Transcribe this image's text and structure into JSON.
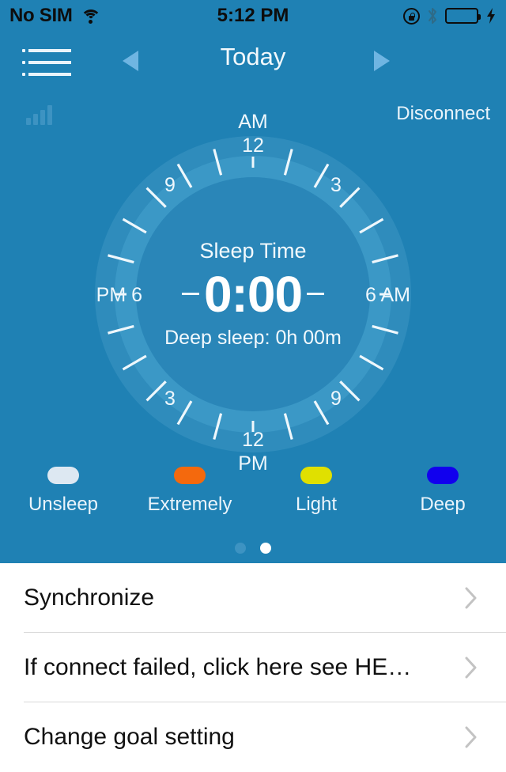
{
  "statusbar": {
    "carrier": "No SIM",
    "wifi_icon": "wifi-icon",
    "time": "5:12 PM",
    "rotation_lock_icon": "rotation-lock-icon",
    "bluetooth_icon": "bluetooth-icon",
    "battery_icon": "battery-icon",
    "battery_color": "#4cd750",
    "charging_icon": "charging-bolt-icon"
  },
  "navbar": {
    "menu_icon": "hamburger-menu-icon",
    "prev_icon": "triangle-left-icon",
    "next_icon": "triangle-right-icon",
    "title": "Today"
  },
  "header": {
    "signal_icon": "signal-bars-icon",
    "disconnect_label": "Disconnect"
  },
  "dial": {
    "top_ampm": "AM",
    "bottom_ampm": "PM",
    "left_label": "PM 6",
    "right_label": "6 AM",
    "hours": {
      "top": "12",
      "top_right": "3",
      "bottom_right": "9",
      "bottom": "12",
      "bottom_left": "3",
      "top_left": "9"
    },
    "center": {
      "title": "Sleep Time",
      "value": "0:00",
      "subtitle": "Deep sleep: 0h 00m"
    }
  },
  "legend": {
    "items": [
      {
        "label": "Unsleep",
        "color": "#dde8f2"
      },
      {
        "label": "Extremely",
        "color": "#f4690d"
      },
      {
        "label": "Light",
        "color": "#e0e000"
      },
      {
        "label": "Deep",
        "color": "#1100ee"
      }
    ]
  },
  "pager": {
    "total": 2,
    "active_index": 1
  },
  "list": {
    "rows": [
      {
        "label": "Synchronize",
        "chevron_icon": "chevron-right-icon"
      },
      {
        "label": "If connect failed, click here see HE…",
        "chevron_icon": "chevron-right-icon"
      },
      {
        "label": "Change goal setting",
        "chevron_icon": "chevron-right-icon"
      }
    ]
  },
  "colors": {
    "panel_blue": "#1f81b4",
    "dial_outer": "#2f8cbc",
    "dial_ring": "#3b98c6",
    "dial_inner": "#2a86b8",
    "accent_arrow": "#6fb5e2"
  }
}
